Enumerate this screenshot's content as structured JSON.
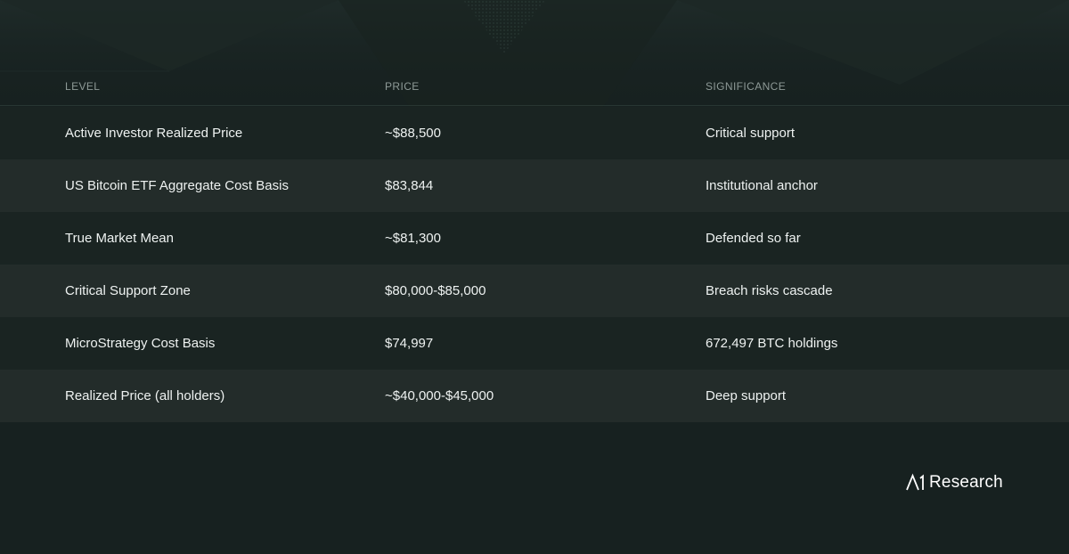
{
  "table": {
    "headers": {
      "level": "LEVEL",
      "price": "PRICE",
      "significance": "SIGNIFICANCE"
    },
    "rows": [
      {
        "level": "Active Investor Realized Price",
        "price": "~$88,500",
        "significance": "Critical support"
      },
      {
        "level": "US Bitcoin ETF Aggregate Cost Basis",
        "price": "$83,844",
        "significance": "Institutional anchor"
      },
      {
        "level": "True Market Mean",
        "price": "~$81,300",
        "significance": "Defended so far"
      },
      {
        "level": "Critical Support Zone",
        "price": "$80,000-$85,000",
        "significance": "Breach risks cascade"
      },
      {
        "level": "MicroStrategy Cost Basis",
        "price": "$74,997",
        "significance": "672,497 BTC holdings"
      },
      {
        "level": "Realized Price (all holders)",
        "price": "~$40,000-$45,000",
        "significance": "Deep support"
      }
    ]
  },
  "brand": {
    "name": "Research",
    "logo_icon": "a1-logo-icon"
  },
  "colors": {
    "background": "#172120",
    "row_alt": "#232c2a",
    "header_text": "#8e9a97",
    "body_text": "#eef2f1"
  }
}
